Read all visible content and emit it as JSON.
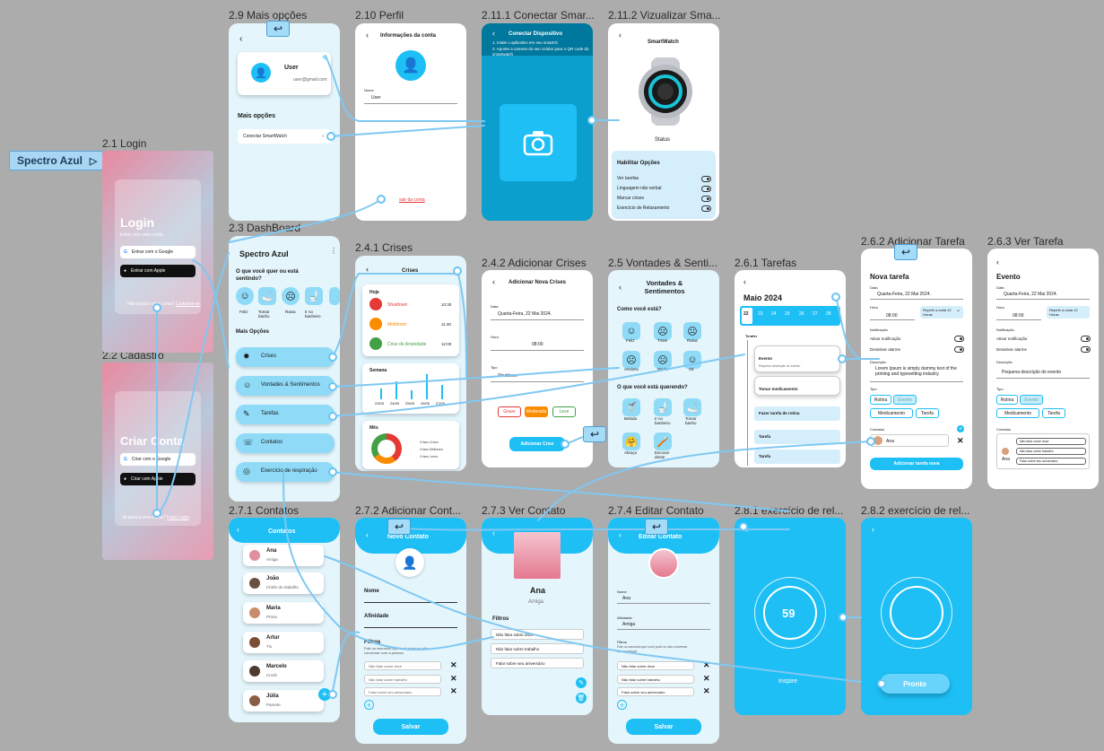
{
  "prototype_label": "Spectro Azul",
  "frames": {
    "f21": "2.1 Login",
    "f22": "2.2 Cadastro",
    "f23": "2.3 DashBoard",
    "f29": "2.9 Mais opções",
    "f210": "2.10 Perfil",
    "f2111": "2.11.1 Conectar Smar...",
    "f2112": "2.11.2 Vizualizar Sma...",
    "f241": "2.4.1 Crises",
    "f242": "2.4.2 Adicionar Crises",
    "f25": "2.5 Vontades & Senti...",
    "f261": "2.6.1 Tarefas",
    "f262": "2.6.2 Adicionar Tarefa",
    "f263": "2.6.3 Ver Tarefa",
    "f271": "2.7.1 Contatos",
    "f272": "2.7.2 Adicionar Cont...",
    "f273": "2.7.3 Ver Contato",
    "f274": "2.7.4 Editar Contato",
    "f281": "2.8.1 exercício de rel...",
    "f282": "2.8.2 exercício de rel..."
  },
  "login": {
    "title": "Login",
    "subtitle": "Entre com uma conta",
    "google": "Entrar com o Google",
    "apple": "Entrar com Apple",
    "footer": "Não possui uma conta?",
    "footer_link": "Cadastre-se"
  },
  "cadastro": {
    "title": "Criar Conta",
    "google": "Criar com o Google",
    "apple": "Criar com Apple",
    "footer": "Já possui uma conta?",
    "footer_link": "Faça Login"
  },
  "dashboard": {
    "title": "Spectro Azul",
    "question": "O que você quer ou está sentindo?",
    "moods": [
      "Feliz",
      "Tomar banho",
      "Raiva",
      "Ir no banheiro"
    ],
    "section": "Mais Opções",
    "items": [
      "Crises",
      "Vontades & Sentimentos",
      "Tarefas",
      "Contatos",
      "Exercício de respiração"
    ]
  },
  "mais": {
    "user": "User",
    "email": "user@gmail.com",
    "section": "Mais opções",
    "connect": "Conectar SmartWatch"
  },
  "perfil": {
    "title": "Informações da conta",
    "name_label": "Nome",
    "name_value": "User",
    "logout": "sair da conta"
  },
  "conectar": {
    "title": "Conectar Dispositivo",
    "step1": "1. Intale o aplicativo em seu smartch",
    "step2": "2. Aponte a camera do seu celular para o QR code do smartwatch"
  },
  "watch": {
    "title": "SmartWatch",
    "status": "Status",
    "section": "Habilitar Opções",
    "options": [
      "Ver tarefas",
      "Linguagem não verbal",
      "Marcar crises",
      "Exercício de Relaxamento"
    ]
  },
  "crises": {
    "title": "Crises",
    "today": "Hoje",
    "items": [
      {
        "name": "Shutdown",
        "time": "10:30",
        "color": "#e53935"
      },
      {
        "name": "Meltdown",
        "time": "11:30",
        "color": "#fb8c00"
      },
      {
        "name": "Crise de Ansiedade",
        "time": "12:00",
        "color": "#43a047"
      }
    ],
    "week": "Semana",
    "days": [
      "23/05",
      "24/05",
      "25/05",
      "26/05",
      "27/05"
    ],
    "month": "Mês",
    "legend": [
      "Crises Crises",
      "Crises Meltdown",
      "Crises Leves"
    ]
  },
  "addcrise": {
    "title": "Adicionar Nova Crises",
    "date_label": "Data",
    "date": "Quarta-Feira, 22 Mai 2024.",
    "hour_label": "Hora",
    "hour": "08:00",
    "type_label": "Tipo",
    "type": "Shutdown",
    "levels": [
      "Grave",
      "Moderada",
      "Leve"
    ],
    "button": "Adicionar Crise"
  },
  "vontades": {
    "title": "Vontades & Sentimentos",
    "q1": "Como você está?",
    "feel": [
      "Feliz",
      "Triste",
      "Raiva",
      "Ansioso",
      "Medo",
      "Ok"
    ],
    "q2": "O que você está querendo?",
    "wants": [
      "Bebida",
      "Ir no banheiro",
      "Tomar banho",
      "Abraço",
      "Escovar dente"
    ]
  },
  "tarefas": {
    "title": "Maio 2024",
    "days": [
      "22",
      "23",
      "24",
      "25",
      "26",
      "27",
      "28"
    ],
    "today": "Terafer",
    "tasks": [
      "Evento",
      "Tomar medicamento",
      "Fazer tarefa de rotina",
      "Tarefa",
      "Tarefa"
    ],
    "event_desc": "Pequena descrição do evento"
  },
  "novatarefa": {
    "title": "Nova tarefa",
    "date_label": "Data",
    "date": "Quarta-Feira, 22 Mai 2024.",
    "hour_label": "Hora",
    "hour": "08:00",
    "repeat": "Repetir a cada 12 Horas",
    "notif": "Notificação",
    "opt1": "Ativar notificação",
    "opt2": "Desativar alarme",
    "desc_label": "Descrição",
    "desc": "Lorem Ipsum is simply dummy text of the printing and typesetting industry.",
    "type_label": "Tipo",
    "types": [
      "Rotina",
      "Evento",
      "Medicamento",
      "Tarefa"
    ],
    "contacts": "Contatos",
    "contact": "Ana",
    "button": "Adicionar tarefa nova"
  },
  "vertarefa": {
    "title": "Evento",
    "desc": "Pequena descrição do evento",
    "filters": [
      "Não falar sobre doce",
      "Não falar sobre trabalho",
      "Falar sobre seu aniversário"
    ],
    "contact": "Ana"
  },
  "contatos": {
    "title": "Contatos",
    "list": [
      {
        "name": "Ana",
        "role": "Amiga"
      },
      {
        "name": "João",
        "role": "Chefe do trabalho"
      },
      {
        "name": "Maria",
        "role": "Prima"
      },
      {
        "name": "Artur",
        "role": "Tio"
      },
      {
        "name": "Marcelo",
        "role": "Crush"
      },
      {
        "name": "Júlia",
        "role": "Parente"
      }
    ]
  },
  "novocontato": {
    "title": "Novo Contato",
    "name": "Nome",
    "affinity": "Afinidade",
    "filters": "Filtros",
    "filters_desc": "Fale os assuntos que você pode ou não conversar com a pessoa",
    "items": [
      "Não falar sobre doce",
      "Não falar sobre trabalho",
      "Falar sobre seu aniversário"
    ],
    "save": "Salvar"
  },
  "vercontato": {
    "name": "Ana",
    "role": "Amiga",
    "filters": "Filtros",
    "items": [
      "Não falar sobre doce",
      "Não falar sobre trabalho",
      "Falar sobre seu aniversário"
    ]
  },
  "editar": {
    "title": "Editar Contato",
    "name_label": "Nome",
    "name": "Ana",
    "aff_label": "Afinidade",
    "aff": "Amiga",
    "filters": "Filtros",
    "filters_desc": "Fale os assuntos que você pode ou não conversar com a pessoa",
    "items": [
      "Não falar sobre doce",
      "Não falar sobre trabalho",
      "Falar sobre seu aniversário"
    ],
    "save": "Salvar"
  },
  "respira": {
    "count": "59",
    "inspire": "Inspire",
    "done": "Pronto"
  }
}
